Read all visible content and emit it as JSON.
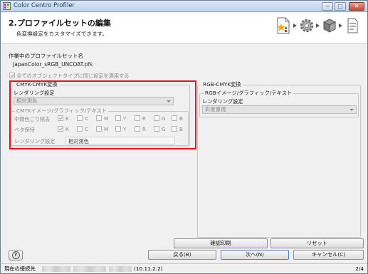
{
  "window": {
    "title": "Color Centro Profiler",
    "min_glyph": "−",
    "max_glyph": "□",
    "close_glyph": "✕"
  },
  "header": {
    "title": "2.プロファイルセットの編集",
    "subtitle": "色変換設定をカスタマイズできます。"
  },
  "profile_section": {
    "label": "作業中のプロファイルセット名",
    "value": "JapanColor_sRGB_UNCOAT.pfs"
  },
  "apply_all": {
    "label": "全てのオブジェクトタイプに同じ設定を適用する",
    "checked": true
  },
  "cmyk_group": {
    "title": "CMYK-CMYK変換",
    "rendering_label": "レンダリング設定",
    "rendering_value": "相対測色",
    "subgroup": {
      "title": "CMYKイメージ/グラフィック/テキスト",
      "rows": [
        {
          "label": "中間色ごり除去",
          "channels": [
            {
              "ch": "K",
              "checked": true
            },
            {
              "ch": "C",
              "checked": false
            },
            {
              "ch": "M",
              "checked": false
            },
            {
              "ch": "Y",
              "checked": false
            },
            {
              "ch": "R",
              "checked": false
            },
            {
              "ch": "G",
              "checked": false
            },
            {
              "ch": "B",
              "checked": false
            }
          ]
        },
        {
          "label": "ベタ保持",
          "channels": [
            {
              "ch": "K",
              "checked": true
            },
            {
              "ch": "C",
              "checked": false
            },
            {
              "ch": "M",
              "checked": false
            },
            {
              "ch": "Y",
              "checked": false
            },
            {
              "ch": "R",
              "checked": false
            },
            {
              "ch": "G",
              "checked": false
            },
            {
              "ch": "B",
              "checked": false
            }
          ]
        }
      ],
      "rendering_label": "レンダリング設定",
      "rendering_value": "相対測色"
    }
  },
  "rgb_group": {
    "title": "RGB-CMYK変換",
    "sub_title": "RGBイメージ/グラフィック/テキスト",
    "rendering_label": "レンダリング設定",
    "rendering_value": "彩度重視"
  },
  "buttons": {
    "print_check": "確認印刷",
    "reset": "リセット",
    "help": "?",
    "back": "戻る(B)",
    "next": "次へ(N)",
    "cancel": "キャンセル(C)"
  },
  "status": {
    "label": "現在の接続先",
    "address": "(10.11.2.2)",
    "page": "2/4"
  },
  "colors": {
    "highlight": "#e5141b",
    "titlebar": "#c9dbee"
  },
  "wizard_icons": [
    "document-star-icon",
    "gear-icon",
    "printer-box-icon",
    "finish-icon"
  ]
}
